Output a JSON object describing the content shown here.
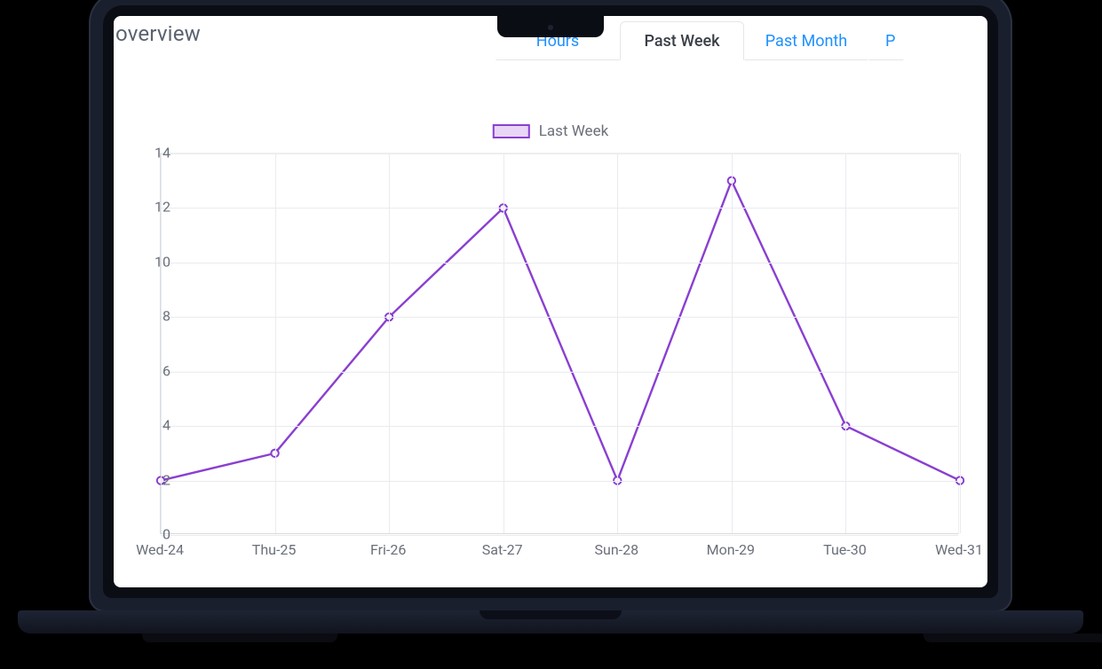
{
  "header": {
    "title": "overview"
  },
  "tabs": [
    {
      "label": "Hours",
      "active": false,
      "clipped_left": true
    },
    {
      "label": "Past Week",
      "active": true
    },
    {
      "label": "Past Month",
      "active": false
    },
    {
      "label": "P",
      "active": false,
      "clipped_right": true
    }
  ],
  "chart_data": {
    "type": "line",
    "title": "",
    "xlabel": "",
    "ylabel": "",
    "categories": [
      "Wed-24",
      "Thu-25",
      "Fri-26",
      "Sat-27",
      "Sun-28",
      "Mon-29",
      "Tue-30",
      "Wed-31"
    ],
    "yticks": [
      0,
      2,
      4,
      6,
      8,
      10,
      12,
      14
    ],
    "ylim": [
      0,
      14
    ],
    "legend_position": "top-center",
    "grid": true,
    "series": [
      {
        "name": "Last Week",
        "color": "#8a3fd1",
        "values": [
          2,
          3,
          8,
          12,
          2,
          13,
          4,
          2
        ]
      }
    ]
  }
}
